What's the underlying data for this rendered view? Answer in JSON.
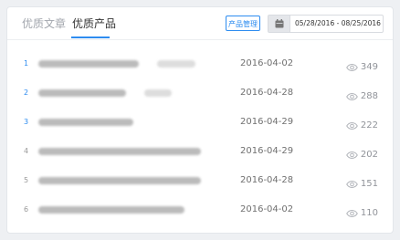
{
  "tabs": [
    {
      "label": "优质文章",
      "active": false
    },
    {
      "label": "优质产品",
      "active": true
    }
  ],
  "toolbar": {
    "manage_label": "产品管理",
    "date_range": "05/28/2016 - 08/25/2016",
    "calendar_icon": "calendar-icon"
  },
  "rows": [
    {
      "rank": "1",
      "date": "2016-04-02",
      "views": "349"
    },
    {
      "rank": "2",
      "date": "2016-04-28",
      "views": "288"
    },
    {
      "rank": "3",
      "date": "2016-04-29",
      "views": "222"
    },
    {
      "rank": "4",
      "date": "2016-04-29",
      "views": "202"
    },
    {
      "rank": "5",
      "date": "2016-04-28",
      "views": "151"
    },
    {
      "rank": "6",
      "date": "2016-04-02",
      "views": "110"
    }
  ],
  "colors": {
    "accent": "#2d8cf0",
    "rank_top": "#2d8cf0",
    "rank_other": "#999999",
    "blur": "#b4b4b4"
  },
  "icons": {
    "views": "eye-icon",
    "date": "calendar-icon"
  }
}
